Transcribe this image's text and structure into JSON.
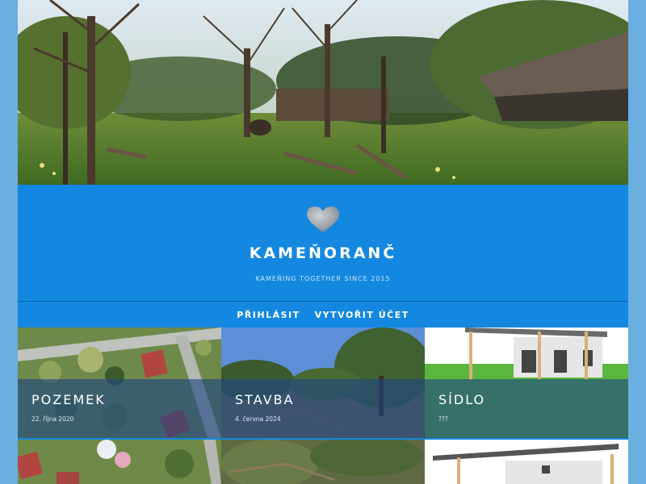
{
  "site": {
    "title": "KAMEŇORANČ",
    "tagline": "KAMEŇING TOGETHER SINCE 2015",
    "logo_icon": "stone-heart-icon"
  },
  "nav": {
    "login": "PŘIHLÁSIT",
    "register": "VYTVOŘIT ÚČET"
  },
  "posts": [
    {
      "title": "POZEMEK",
      "date": "22. října 2020"
    },
    {
      "title": "STAVBA",
      "date": "4. června 2024"
    },
    {
      "title": "SÍDLO",
      "date": "???"
    }
  ],
  "colors": {
    "background": "#6aaee0",
    "brand": "#1488e0",
    "overlay": "#1e4682"
  }
}
